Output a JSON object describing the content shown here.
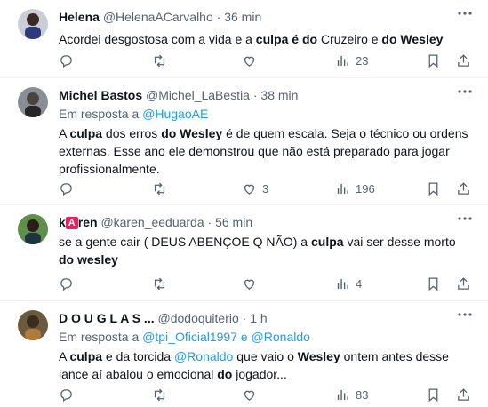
{
  "tweets": [
    {
      "name": "Helena",
      "handle": "@HelenaACarvalho",
      "time": "36 min",
      "text_parts": [
        "Acordei desgostosa com a vida e a ",
        "culpa",
        " ",
        "é",
        " ",
        "do",
        " Cruzeiro e ",
        "do Wesley"
      ],
      "stats": {
        "replies": "",
        "retweets": "",
        "likes": "",
        "views": "23"
      }
    },
    {
      "name": "Michel Bastos",
      "handle": "@Michel_LaBestia",
      "time": "38 min",
      "reply_prefix": "Em resposta a ",
      "reply_to": "@HugaoAE",
      "text_parts": [
        "A ",
        "culpa",
        " dos erros ",
        "do Wesley",
        " é de quem escala. Seja o técnico ou ordens externas. Esse ano ele demonstrou que não está preparado para jogar profissionalmente."
      ],
      "stats": {
        "replies": "",
        "retweets": "",
        "likes": "3",
        "views": "196"
      }
    },
    {
      "name_prefix": "k",
      "name_badge": "A",
      "name_suffix": "ren",
      "handle": "@karen_eeduarda",
      "time": "56 min",
      "text_parts": [
        "se a gente cair  ( DEUS ABENÇOE Q NÃO) a ",
        "culpa",
        " vai ser desse morto ",
        "do wesley"
      ],
      "stats": {
        "replies": "",
        "retweets": "",
        "likes": "",
        "views": "4"
      }
    },
    {
      "name": "D O U G L A S ...",
      "handle": "@dodoquiterio",
      "time": "1 h",
      "reply_prefix": "Em resposta a ",
      "reply_to": "@tpi_Oficial1997 e @Ronaldo",
      "text_parts": [
        "A ",
        "culpa",
        " e da torcida ",
        "@Ronaldo",
        " que vaio o ",
        "Wesley",
        " ontem antes desse lance aí abalou o emocional ",
        "do",
        " ",
        "jogador..."
      ],
      "stats": {
        "replies": "",
        "retweets": "",
        "likes": "",
        "views": "83"
      }
    }
  ],
  "separator": "·",
  "colors": {
    "accent": "#1d9bf0",
    "muted": "#536471",
    "text": "#0f1419"
  },
  "icons": [
    "reply-icon",
    "retweet-icon",
    "like-icon",
    "views-icon",
    "bookmark-icon",
    "share-icon",
    "more-icon"
  ]
}
